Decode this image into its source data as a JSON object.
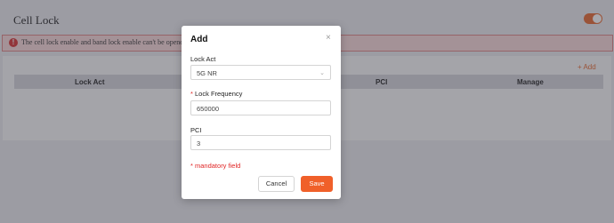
{
  "page": {
    "title": "Cell Lock",
    "toggle_on": true,
    "alert_icon": "!",
    "alert_text": "The cell lock enable and band lock enable can't be opened at the same time",
    "add_link": "+ Add",
    "table_columns": [
      "Lock Act",
      "PCI",
      "Manage"
    ]
  },
  "modal": {
    "title": "Add",
    "close_glyph": "×",
    "lock_act_label": "Lock Act",
    "lock_act_value": "5G NR",
    "caret_glyph": "⌄",
    "freq_required_mark": "*",
    "freq_label": "Lock Frequency",
    "freq_value": "650000",
    "pci_label": "PCI",
    "pci_value": "3",
    "mandatory_note": "* mandatory field",
    "cancel_label": "Cancel",
    "save_label": "Save"
  },
  "colors": {
    "accent": "#f0602a",
    "required": "#e02424",
    "alert_bg": "#f9d9d9"
  }
}
